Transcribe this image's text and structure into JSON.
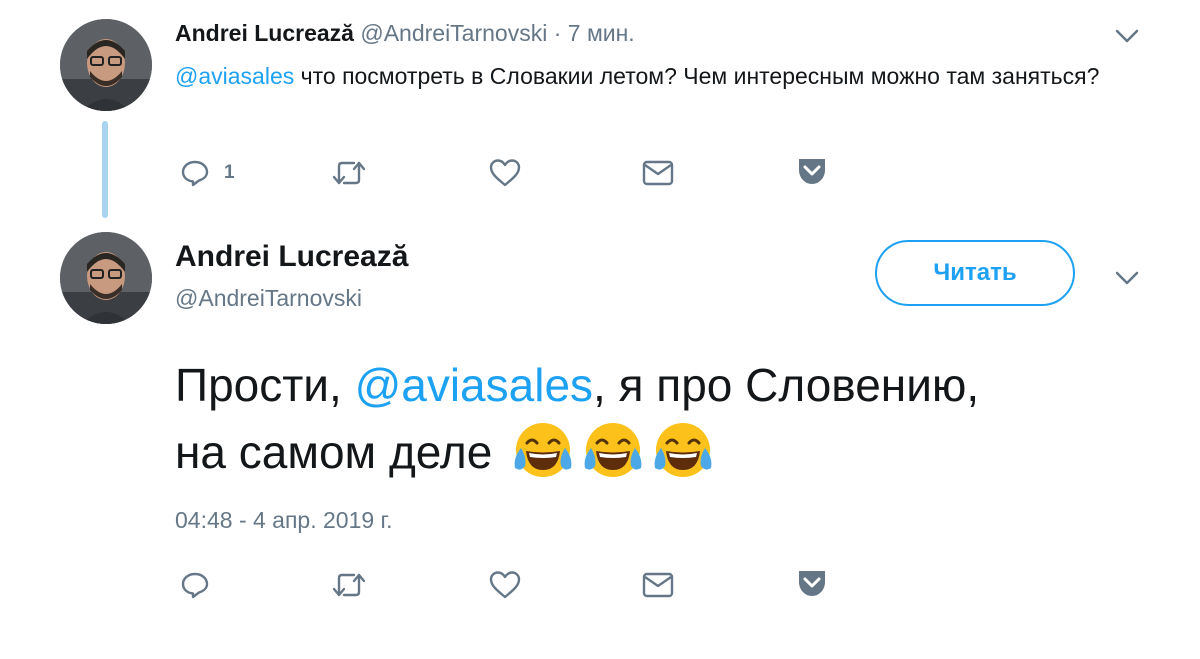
{
  "tweet1": {
    "name": "Andrei Lucrează",
    "handle": "@AndreiTarnovski",
    "time": "· 7 мин.",
    "mention": "@aviasales",
    "text": " что посмотреть в Словакии летом? Чем интересным можно там заняться?",
    "reply_count": "1"
  },
  "tweet2": {
    "name": "Andrei Lucrează",
    "handle": "@AndreiTarnovski",
    "follow_label": "Читать",
    "text_before": "Прости, ",
    "mention": "@aviasales",
    "text_after": ", я про Словению,",
    "line2": "на самом деле",
    "emoji": [
      "face-with-tears-of-joy",
      "face-with-tears-of-joy",
      "face-with-tears-of-joy"
    ],
    "timestamp": "04:48 - 4 апр. 2019 г."
  },
  "colors": {
    "accent": "#1da1f2",
    "text": "#14171a",
    "secondary": "#657786",
    "thread_line": "#a8d4f0"
  }
}
